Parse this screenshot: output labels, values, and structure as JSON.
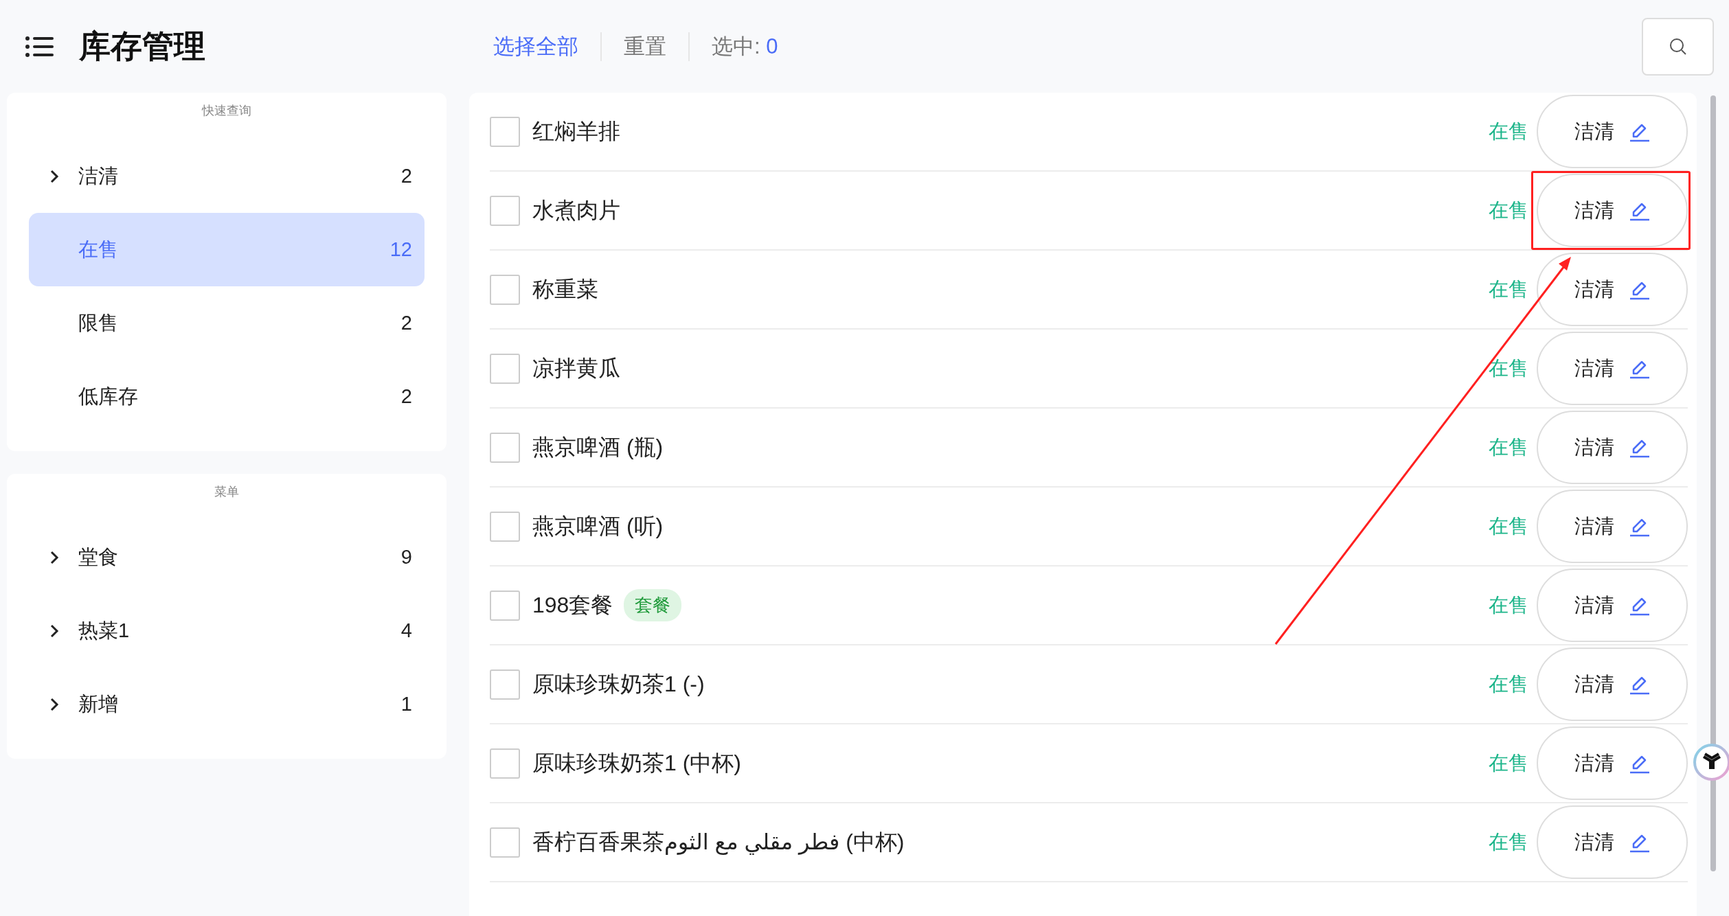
{
  "header": {
    "title": "库存管理",
    "actions": [
      {
        "label": "选择全部",
        "kind": "link"
      },
      {
        "label": "重置",
        "kind": "plain"
      }
    ],
    "selected_label": "选中: ",
    "selected_count": "0"
  },
  "sidebar": {
    "sections": [
      {
        "title": "快速查询",
        "items": [
          {
            "label": "洁清",
            "count": "2",
            "expandable": true,
            "selected": false
          },
          {
            "label": "在售",
            "count": "12",
            "expandable": false,
            "selected": true
          },
          {
            "label": "限售",
            "count": "2",
            "expandable": false,
            "selected": false
          },
          {
            "label": "低库存",
            "count": "2",
            "expandable": false,
            "selected": false
          }
        ]
      },
      {
        "title": "菜单",
        "items": [
          {
            "label": "堂食",
            "count": "9",
            "expandable": true,
            "selected": false
          },
          {
            "label": "热菜1",
            "count": "4",
            "expandable": true,
            "selected": false
          },
          {
            "label": "新增",
            "count": "1",
            "expandable": true,
            "selected": false
          }
        ]
      }
    ]
  },
  "items": [
    {
      "name": "红焖羊排",
      "status": "在售",
      "action": "洁清",
      "checked": false,
      "highlighted": false
    },
    {
      "name": "水煮肉片",
      "status": "在售",
      "action": "洁清",
      "checked": false,
      "highlighted": true
    },
    {
      "name": "称重菜",
      "status": "在售",
      "action": "洁清",
      "checked": false,
      "highlighted": false
    },
    {
      "name": "凉拌黄瓜",
      "status": "在售",
      "action": "洁清",
      "checked": false,
      "highlighted": false
    },
    {
      "name": "燕京啤酒 (瓶)",
      "status": "在售",
      "action": "洁清",
      "checked": false,
      "highlighted": false
    },
    {
      "name": "燕京啤酒 (听)",
      "status": "在售",
      "action": "洁清",
      "checked": false,
      "highlighted": false
    },
    {
      "name": "198套餐",
      "tag": "套餐",
      "status": "在售",
      "action": "洁清",
      "checked": false,
      "highlighted": false
    },
    {
      "name": "原味珍珠奶茶1 (-)",
      "status": "在售",
      "action": "洁清",
      "checked": false,
      "highlighted": false
    },
    {
      "name": "原味珍珠奶茶1 (中杯)",
      "status": "在售",
      "action": "洁清",
      "checked": false,
      "highlighted": false
    },
    {
      "name": "香柠百香果茶فطر مقلي مع الثوم (中杯)",
      "status": "在售",
      "action": "洁清",
      "checked": false,
      "highlighted": false
    }
  ]
}
